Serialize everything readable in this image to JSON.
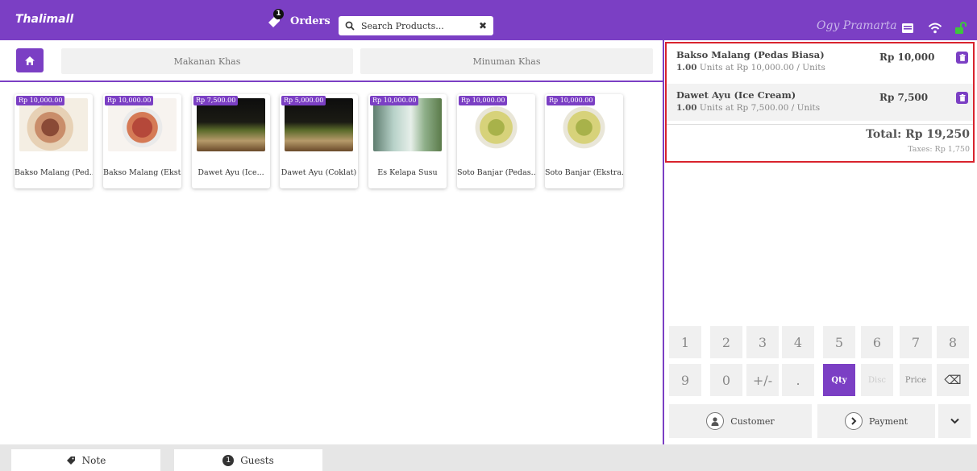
{
  "header": {
    "logo_text": "Thalimall",
    "orders_label": "Orders",
    "orders_count": "1",
    "search_placeholder": "Search Products...",
    "user_name": "Ogy Pramarta",
    "icons": [
      "card-icon",
      "wifi-icon",
      "unlock-icon"
    ]
  },
  "categories": {
    "home_icon": "home-icon",
    "items": [
      "Makanan Khas",
      "Minuman Khas"
    ]
  },
  "products": [
    {
      "price": "Rp 10,000.00",
      "name": "Bakso Malang (Ped...",
      "color": "#a0634a"
    },
    {
      "price": "Rp 10,000.00",
      "name": "Bakso Malang (Ekst...",
      "color": "#b5483a"
    },
    {
      "price": "Rp 7,500.00",
      "name": "Dawet Ayu (Ice...",
      "color": "#3b4a2a"
    },
    {
      "price": "Rp 5,000.00",
      "name": "Dawet Ayu (Coklat)",
      "color": "#34402a"
    },
    {
      "price": "Rp 10,000.00",
      "name": "Es Kelapa Susu",
      "color": "#9fbfb6"
    },
    {
      "price": "Rp 10,000.00",
      "name": "Soto Banjar (Pedas...",
      "color": "#c9c07a"
    },
    {
      "price": "Rp 10,000.00",
      "name": "Soto Banjar (Ekstra...",
      "color": "#c7be78"
    }
  ],
  "order": {
    "lines": [
      {
        "name": "Bakso Malang (Pedas Biasa)",
        "qty": "1.00",
        "detail": "Units at Rp 10,000.00 / Units",
        "price": "Rp 10,000"
      },
      {
        "name": "Dawet Ayu (Ice Cream)",
        "qty": "1.00",
        "detail": "Units at Rp 7,500.00 / Units",
        "price": "Rp 7,500"
      }
    ],
    "total": "Total: Rp 19,250",
    "taxes": "Taxes: Rp 1,750"
  },
  "numpad": {
    "row1": [
      "1",
      "2",
      "3",
      "4",
      "5",
      "6",
      "7",
      "8"
    ],
    "row2": [
      "9",
      "0",
      "+/-",
      ".",
      "Qty",
      "Disc",
      "Price",
      "⌫"
    ],
    "customer_label": "Customer",
    "payment_label": "Payment"
  },
  "bottom": {
    "note_label": "Note",
    "guests_label": "Guests",
    "guests_count": "1"
  },
  "colors": {
    "accent": "#7b3fc4",
    "highlight_border": "#d9232d"
  }
}
